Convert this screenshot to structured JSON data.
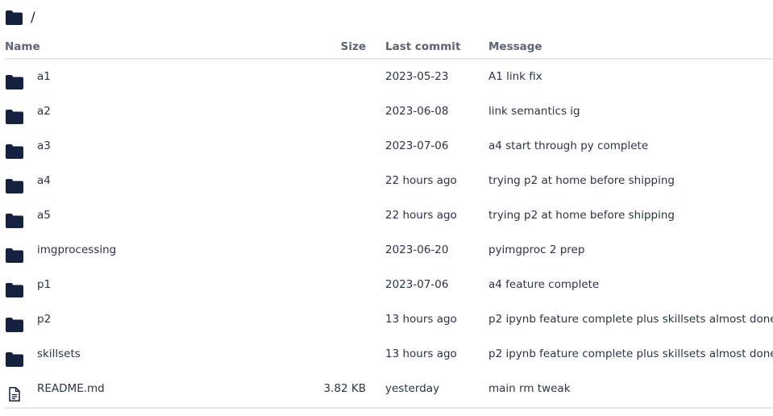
{
  "breadcrumb": {
    "path": "/",
    "icon": "folder-icon"
  },
  "columns": {
    "name": "Name",
    "size": "Size",
    "last_commit": "Last commit",
    "message": "Message"
  },
  "rows": [
    {
      "type": "folder",
      "icon": "folder-icon",
      "name": "a1",
      "size": "",
      "last_commit": "2023-05-23",
      "message": "A1 link fix"
    },
    {
      "type": "folder",
      "icon": "folder-icon",
      "name": "a2",
      "size": "",
      "last_commit": "2023-06-08",
      "message": "link semantics ig"
    },
    {
      "type": "folder",
      "icon": "folder-icon",
      "name": "a3",
      "size": "",
      "last_commit": "2023-07-06",
      "message": "a4 start through py complete"
    },
    {
      "type": "folder",
      "icon": "folder-icon",
      "name": "a4",
      "size": "",
      "last_commit": "22 hours ago",
      "message": "trying p2 at home before shipping"
    },
    {
      "type": "folder",
      "icon": "folder-icon",
      "name": "a5",
      "size": "",
      "last_commit": "22 hours ago",
      "message": "trying p2 at home before shipping"
    },
    {
      "type": "folder",
      "icon": "folder-icon",
      "name": "imgprocessing",
      "size": "",
      "last_commit": "2023-06-20",
      "message": "pyimgproc 2 prep"
    },
    {
      "type": "folder",
      "icon": "folder-icon",
      "name": "p1",
      "size": "",
      "last_commit": "2023-07-06",
      "message": "a4 feature complete"
    },
    {
      "type": "folder",
      "icon": "folder-icon",
      "name": "p2",
      "size": "",
      "last_commit": "13 hours ago",
      "message": "p2 ipynb feature complete plus skillsets almost done"
    },
    {
      "type": "folder",
      "icon": "folder-icon",
      "name": "skillsets",
      "size": "",
      "last_commit": "13 hours ago",
      "message": "p2 ipynb feature complete plus skillsets almost done"
    },
    {
      "type": "file",
      "icon": "file-text-icon",
      "name": "README.md",
      "size": "3.82 KB",
      "last_commit": "yesterday",
      "message": "main rm tweak"
    }
  ],
  "colors": {
    "icon": "#14223f",
    "header_text": "#5b6475",
    "rule": "#e4e6ea"
  }
}
